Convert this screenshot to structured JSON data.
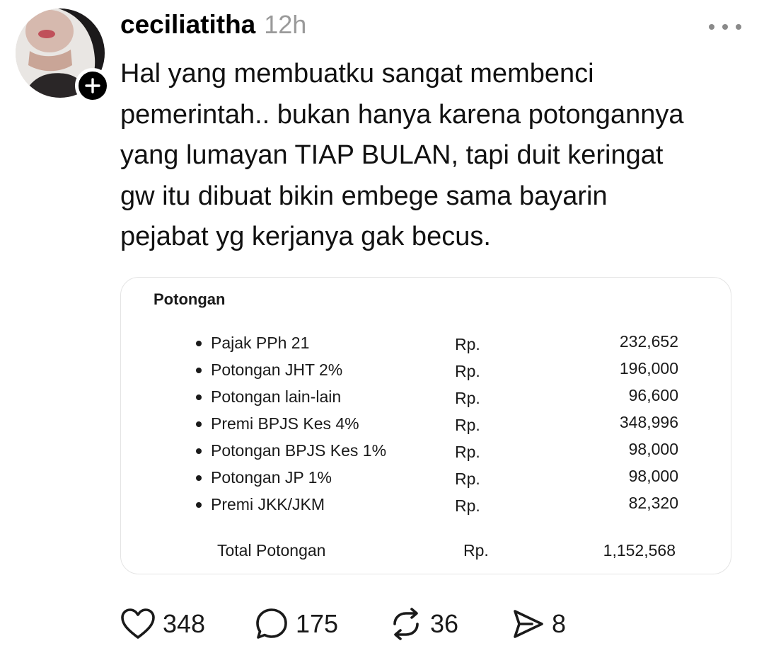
{
  "post": {
    "username": "ceciliatitha",
    "timestamp": "12h",
    "text_lines": [
      "Hal yang membuatku sangat membenci",
      "pemerintah.. bukan hanya karena potongannya",
      "yang lumayan TIAP BULAN, tapi duit keringat",
      "gw itu dibuat bikin embege sama bayarin",
      "pejabat yg kerjanya gak becus."
    ]
  },
  "image": {
    "title": "Potongan",
    "rows": [
      {
        "label": "Pajak PPh 21",
        "currency": "Rp.",
        "amount": "232,652"
      },
      {
        "label": "Potongan JHT 2%",
        "currency": "Rp.",
        "amount": "196,000"
      },
      {
        "label": "Potongan lain-lain",
        "currency": "Rp.",
        "amount": "96,600"
      },
      {
        "label": "Premi BPJS Kes 4%",
        "currency": "Rp.",
        "amount": "348,996"
      },
      {
        "label": "Potongan BPJS Kes 1%",
        "currency": "Rp.",
        "amount": "98,000"
      },
      {
        "label": "Potongan JP 1%",
        "currency": "Rp.",
        "amount": "98,000"
      },
      {
        "label": "Premi JKK/JKM",
        "currency": "Rp.",
        "amount": "82,320"
      }
    ],
    "total": {
      "label": "Total Potongan",
      "currency": "Rp.",
      "amount": "1,152,568"
    }
  },
  "actions": {
    "likes": "348",
    "replies": "175",
    "reposts": "36",
    "shares": "8"
  },
  "icons": {
    "like": "heart-icon",
    "reply": "speech-bubble-icon",
    "repost": "repost-arrows-icon",
    "share": "send-icon",
    "more": "more-dots-icon",
    "follow": "plus-icon"
  },
  "colors": {
    "text": "#000000",
    "muted": "#9a9a9a",
    "card_border": "#e4e4e4"
  }
}
